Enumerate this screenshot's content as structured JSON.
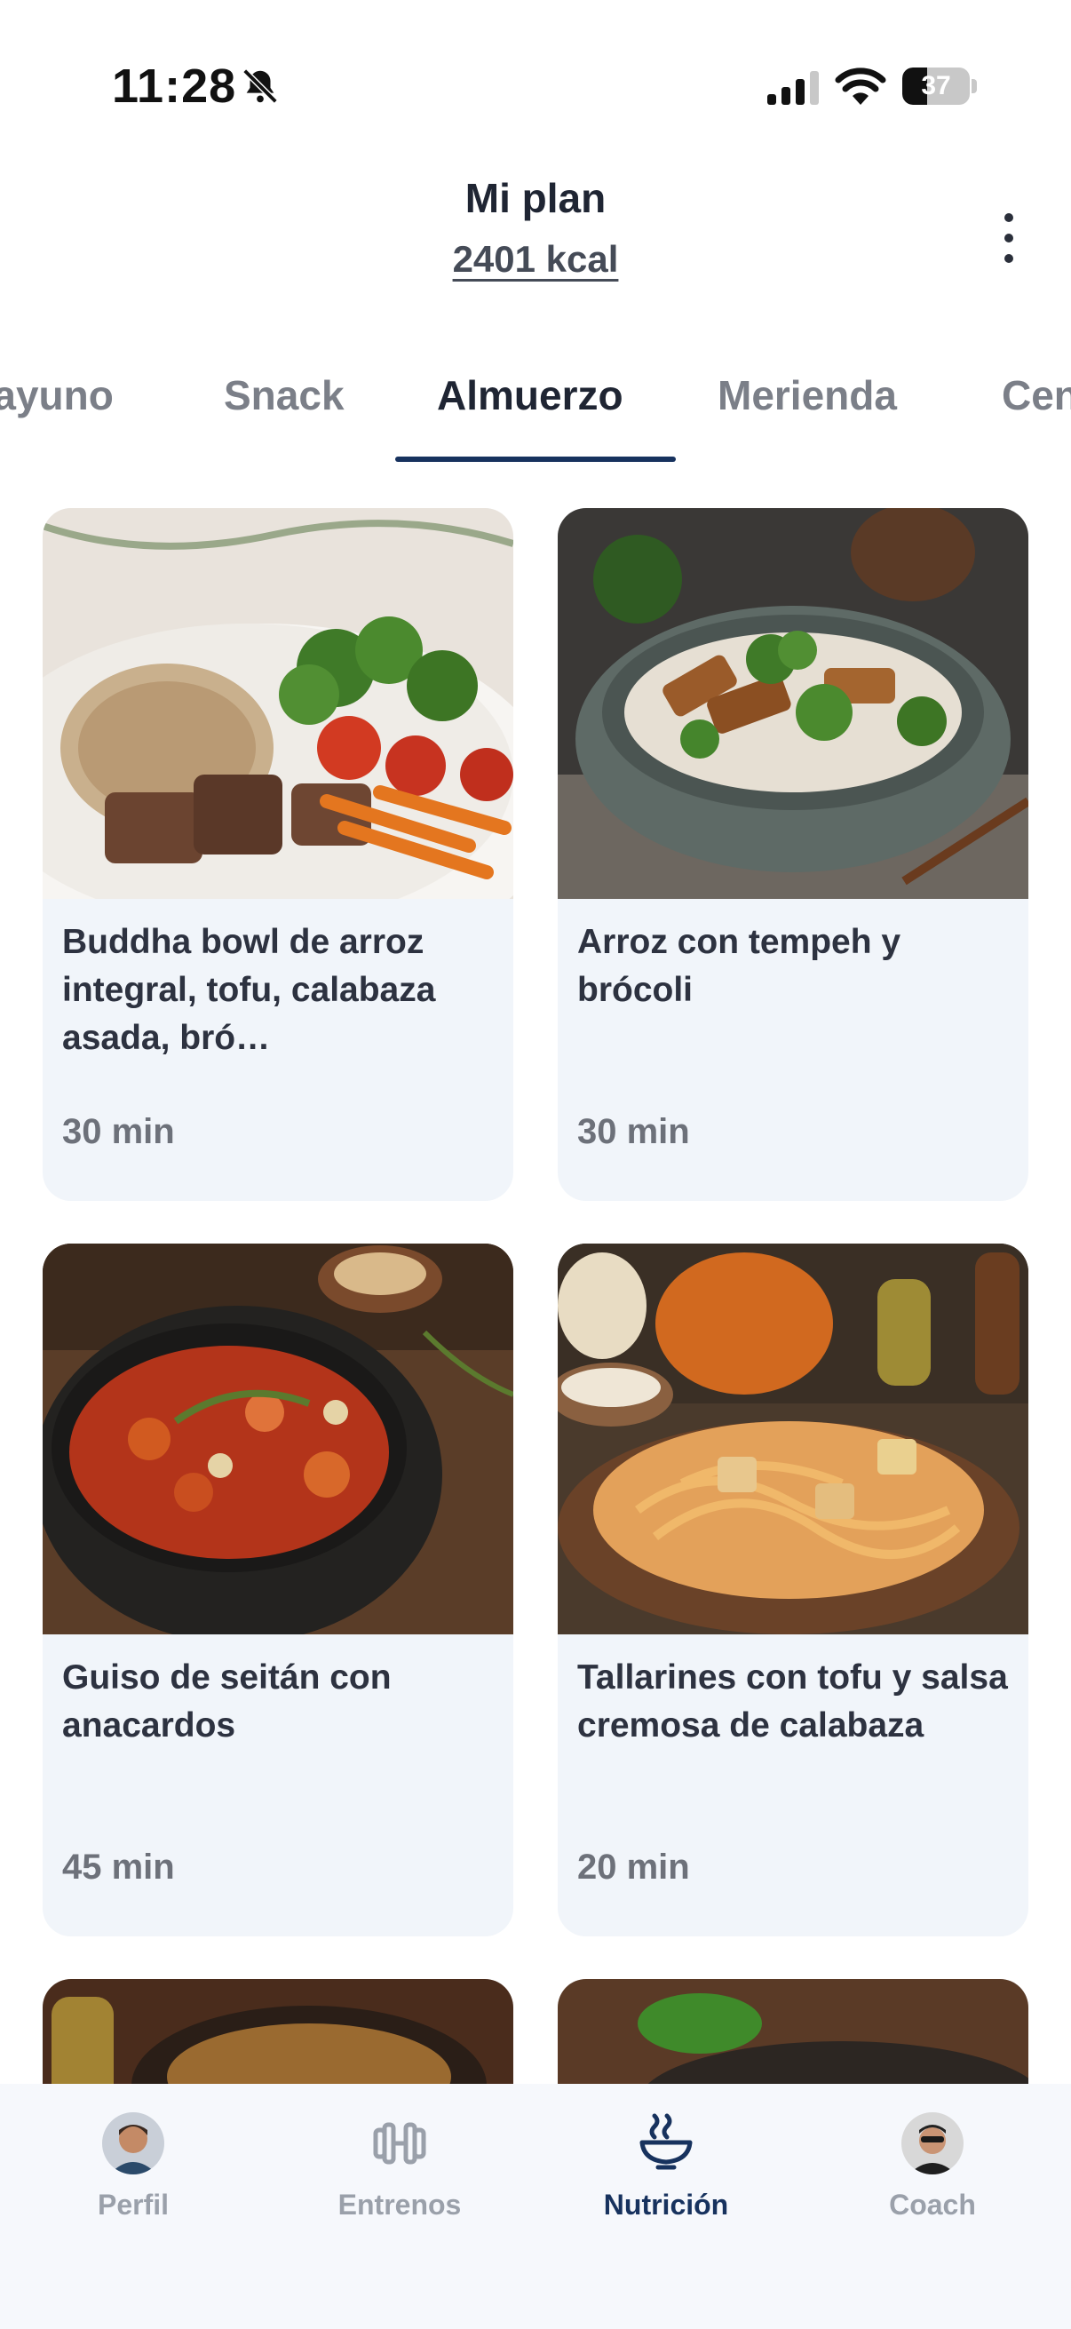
{
  "status_bar": {
    "time": "11:28",
    "battery_percent": "37",
    "battery_level": 0.37
  },
  "header": {
    "title": "Mi plan",
    "kcal": "2401 kcal"
  },
  "tabs": [
    {
      "label": "Desayuno"
    },
    {
      "label": "Snack"
    },
    {
      "label": "Almuerzo",
      "active": true
    },
    {
      "label": "Merienda"
    },
    {
      "label": "Cena"
    }
  ],
  "recipes": [
    {
      "title": "Buddha bowl de arroz integral, tofu, calabaza asada, bró…",
      "time": "30 min"
    },
    {
      "title": "Arroz con tempeh y brócoli",
      "time": "30 min"
    },
    {
      "title": "Guiso de seitán con anacardos",
      "time": "45 min"
    },
    {
      "title": "Tallarines con tofu y salsa cremosa de calabaza",
      "time": "20 min"
    }
  ],
  "bottom_nav": [
    {
      "label": "Perfil"
    },
    {
      "label": "Entrenos"
    },
    {
      "label": "Nutrición",
      "active": true
    },
    {
      "label": "Coach"
    }
  ],
  "colors": {
    "accent": "#17325e",
    "card_bg": "#f1f5fa",
    "inactive": "#9aa0aa"
  }
}
